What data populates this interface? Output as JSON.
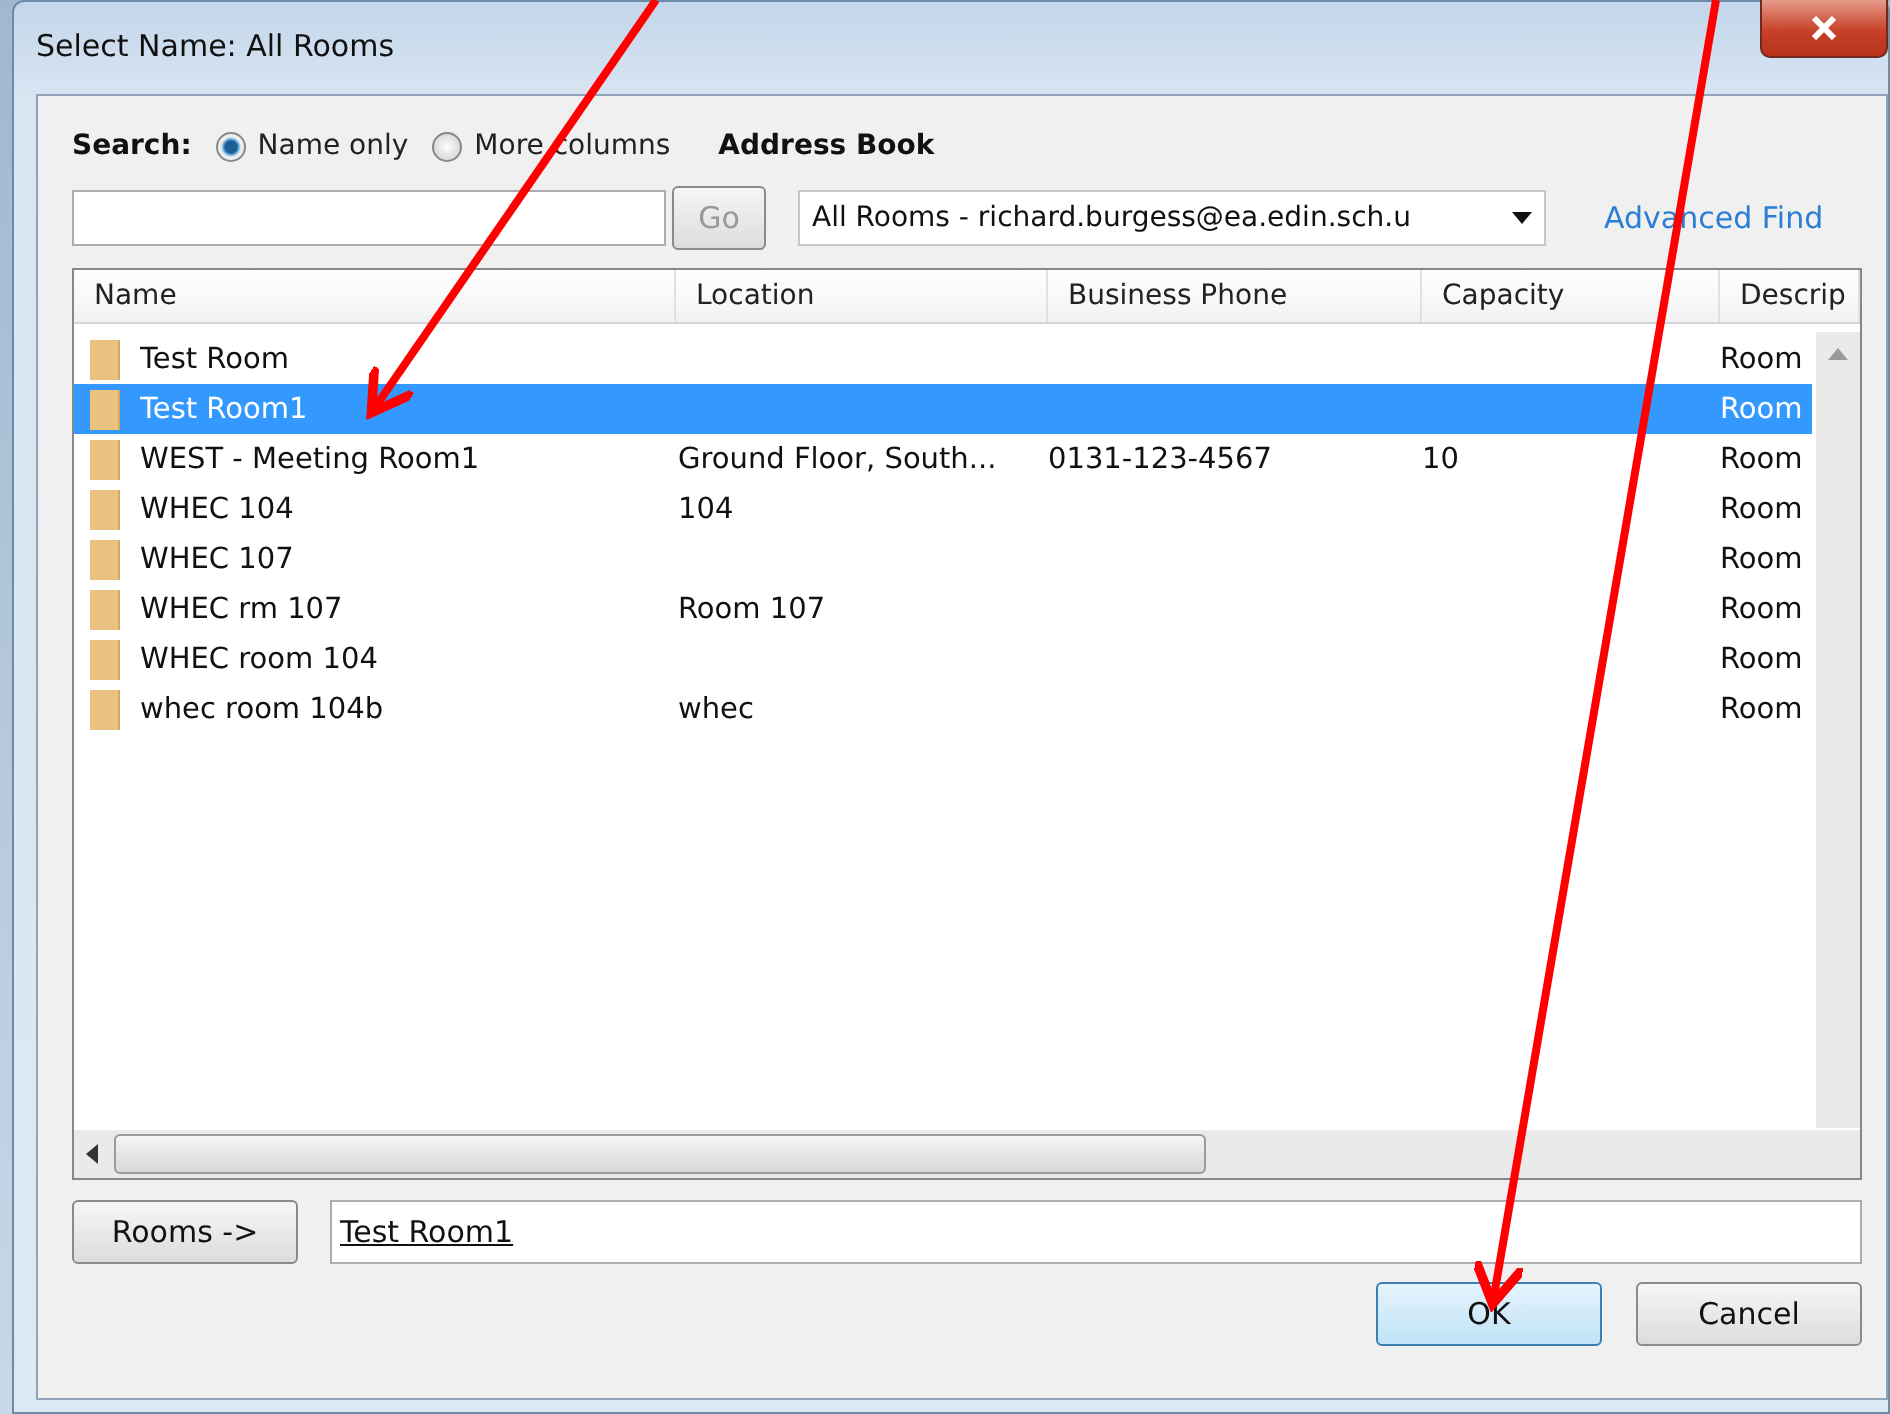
{
  "window": {
    "title": "Select Name: All Rooms"
  },
  "search": {
    "label": "Search:",
    "options": [
      {
        "label": "Name only",
        "selected": true
      },
      {
        "label": "More columns",
        "selected": false
      }
    ]
  },
  "go_button": {
    "label": "Go",
    "disabled": true
  },
  "address_book": {
    "label": "Address Book",
    "value": "All Rooms - richard.burgess@ea.edin.sch.u"
  },
  "advanced_find": "Advanced Find",
  "columns": [
    "Name",
    "Location",
    "Business Phone",
    "Capacity",
    "Descrip"
  ],
  "rows": [
    {
      "cells": [
        "Test Room",
        "",
        "",
        "",
        "Room"
      ],
      "selected": false
    },
    {
      "cells": [
        "Test Room1",
        "",
        "",
        "",
        "Room"
      ],
      "selected": true
    },
    {
      "cells": [
        "WEST - Meeting Room1",
        "Ground Floor, South...",
        "0131-123-4567",
        "10",
        "Room"
      ],
      "selected": false
    },
    {
      "cells": [
        "WHEC 104",
        "104",
        "",
        "",
        "Room"
      ],
      "selected": false
    },
    {
      "cells": [
        "WHEC 107",
        "",
        "",
        "",
        "Room"
      ],
      "selected": false
    },
    {
      "cells": [
        "WHEC rm 107",
        "Room 107",
        "",
        "",
        "Room"
      ],
      "selected": false
    },
    {
      "cells": [
        "WHEC room 104",
        "",
        "",
        "",
        "Room"
      ],
      "selected": false
    },
    {
      "cells": [
        "whec room 104b",
        "whec",
        "",
        "",
        "Room"
      ],
      "selected": false
    }
  ],
  "rooms_button": "Rooms ->",
  "recipient": "Test Room1",
  "buttons": [
    {
      "label": "OK",
      "default": true
    },
    {
      "label": "Cancel",
      "default": false
    }
  ]
}
